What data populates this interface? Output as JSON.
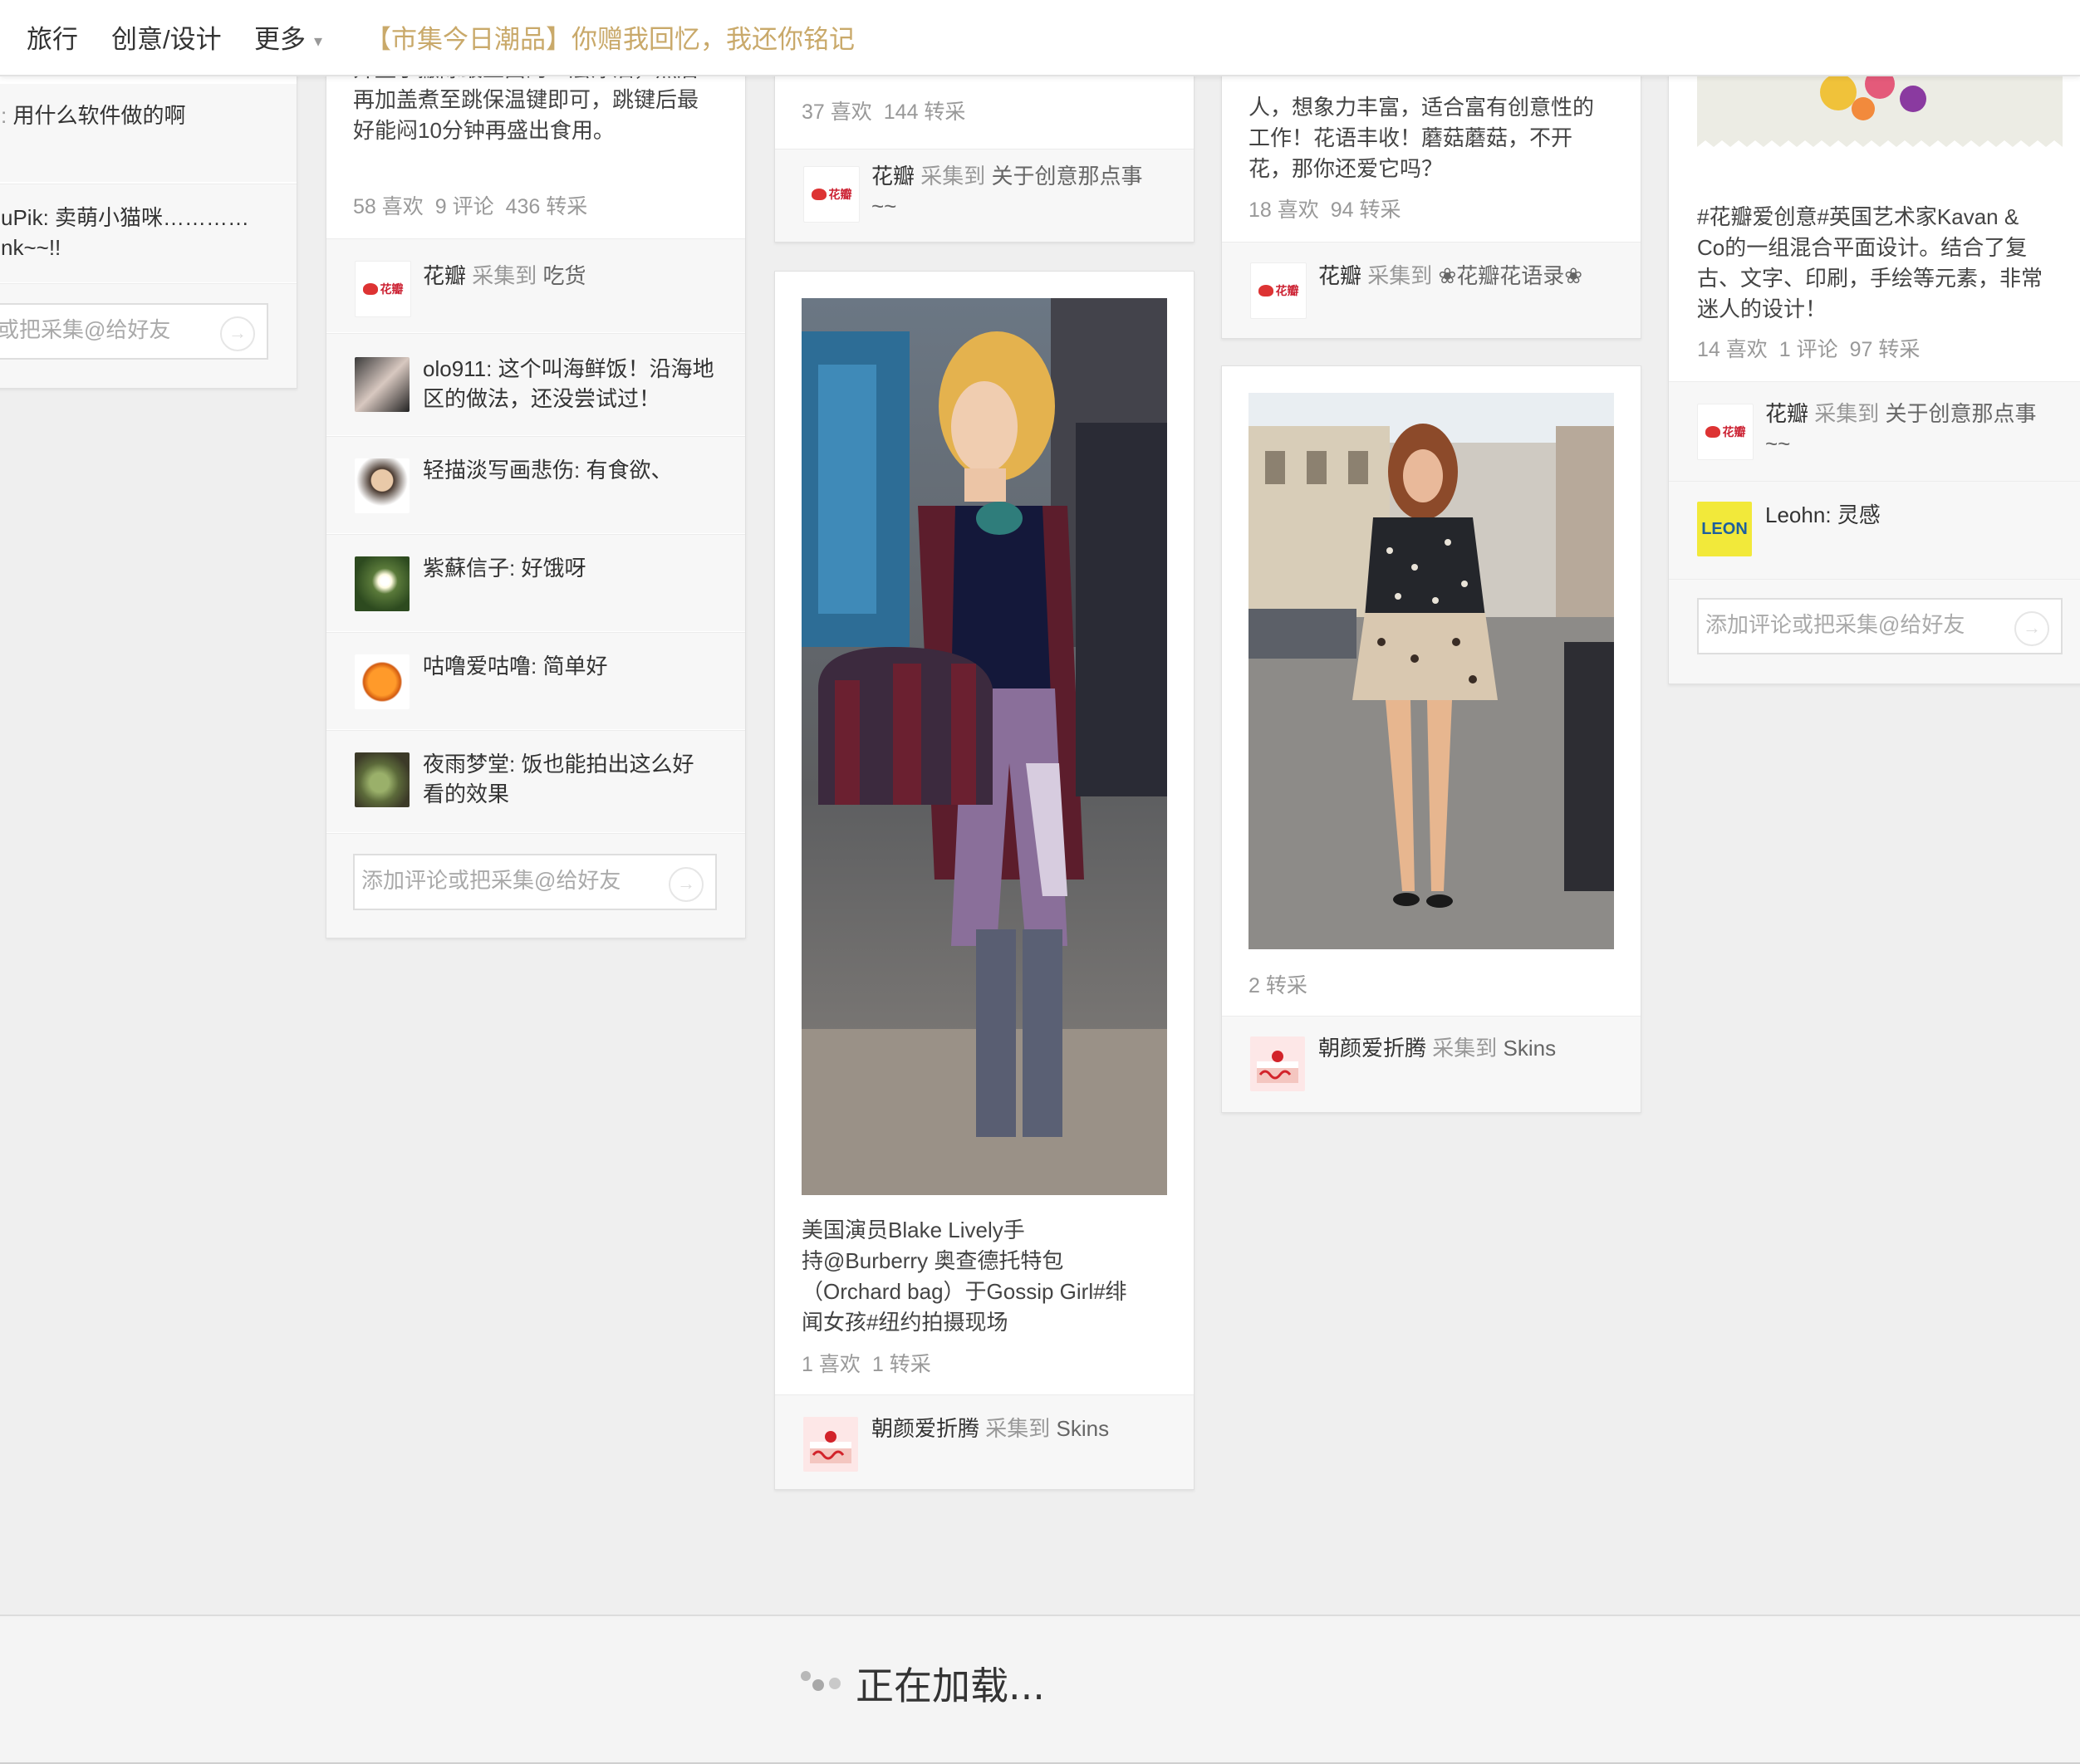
{
  "nav": {
    "items": [
      "旅行",
      "创意/设计",
      "更多"
    ],
    "promo": "【市集今日潮品】你赠我回忆，我还你铭记"
  },
  "col0": {
    "comments": [
      "用什么软件做的啊",
      "uPik: 卖萌小猫咪…………",
      "nk~~!!"
    ],
    "input_placeholder": "或把采集@给好友"
  },
  "col1": {
    "desc": [
      "开盖子撇除最上面的一层浮油，然后",
      "再加盖煮至跳保温键即可，跳键后最",
      "好能闷10分钟再盛出食用。"
    ],
    "stats": {
      "likes": "58 喜欢",
      "comments": "9 评论",
      "repins": "436 转采"
    },
    "collector": "花瓣",
    "via": "采集到",
    "board": "吃货",
    "comments": [
      {
        "user": "olo911",
        "text": "这个叫海鲜饭！沿海地区的做法，还没尝试过！"
      },
      {
        "user": "轻描淡写画悲伤",
        "text": "有食欲、"
      },
      {
        "user": "紫蘇信子",
        "text": "好饿呀"
      },
      {
        "user": "咕噜爱咕噜",
        "text": "简单好"
      },
      {
        "user": "夜雨梦堂",
        "text": "饭也能拍出这么好看的效果"
      }
    ],
    "input_placeholder": "添加评论或把采集@给好友"
  },
  "col2": {
    "card1": {
      "stats": {
        "likes": "37 喜欢",
        "repins": "144 转采"
      },
      "collector": "花瓣",
      "via": "采集到",
      "board": "关于创意那点事",
      "board_suffix": "~~"
    },
    "card2": {
      "desc": [
        "美国演员Blake Lively手",
        "持@Burberry 奥查德托特包",
        "（Orchard bag）于Gossip Girl#绯",
        "闻女孩#纽约拍摄现场"
      ],
      "stats": {
        "likes": "1 喜欢",
        "repins": "1 转采"
      },
      "collector": "朝颜爱折腾",
      "via": "采集到",
      "board": "Skins"
    }
  },
  "col3": {
    "card1": {
      "desc": [
        "人，想象力丰富，适合富有创意性的",
        "工作！花语丰收！蘑菇蘑菇，不开",
        "花，那你还爱它吗？"
      ],
      "stats": {
        "likes": "18 喜欢",
        "repins": "94 转采"
      },
      "collector": "花瓣",
      "via": "采集到",
      "board": "❀花瓣花语录❀"
    },
    "card2": {
      "stats": {
        "repins": "2 转采"
      },
      "collector": "朝颜爱折腾",
      "via": "采集到",
      "board": "Skins"
    }
  },
  "col4": {
    "desc": [
      "#花瓣爱创意#英国艺术家Kavan &",
      "Co的一组混合平面设计。结合了复",
      "古、文字、印刷，手绘等元素，非常",
      "迷人的设计！"
    ],
    "stats": {
      "likes": "14 喜欢",
      "comments": "1 评论",
      "repins": "97 转采"
    },
    "collector": "花瓣",
    "via": "采集到",
    "board": "关于创意那点事",
    "board_suffix": "~~",
    "comment": {
      "user": "Leohn",
      "text": "灵感"
    },
    "leon_logo": "LEON",
    "input_placeholder": "添加评论或把采集@给好友"
  },
  "loading": "正在加载..."
}
